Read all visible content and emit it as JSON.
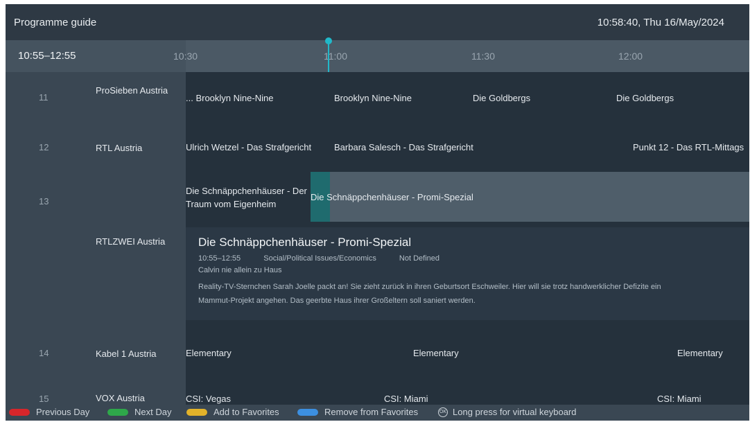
{
  "header": {
    "title": "Programme guide",
    "clock": "10:58:40, Thu 16/May/2024"
  },
  "timeline": {
    "range": "10:55–12:55",
    "ticks": [
      "10:30",
      "11:00",
      "11:30",
      "12:00"
    ]
  },
  "channels": [
    {
      "number": "11",
      "name": "ProSieben Austria",
      "programmes": [
        "... Brooklyn Nine-Nine",
        "Brooklyn Nine-Nine",
        "Die Goldbergs",
        "Die Goldbergs"
      ]
    },
    {
      "number": "12",
      "name": "RTL Austria",
      "programmes": [
        "Ulrich Wetzel - Das Strafgericht",
        "Barbara Salesch - Das Strafgericht",
        "Punkt 12 - Das RTL-Mittags"
      ]
    },
    {
      "number": "13",
      "name": "RTLZWEI Austria",
      "programmes": [
        "Die Schnäppchenhäuser - Der Traum vom Eigenheim",
        "Die Schnäppchenhäuser - Promi-Spezial"
      ]
    },
    {
      "number": "14",
      "name": "Kabel 1 Austria",
      "programmes": [
        "Elementary",
        "Elementary",
        "Elementary"
      ]
    },
    {
      "number": "15",
      "name": "VOX Austria",
      "programmes": [
        "CSI: Vegas",
        "CSI: Miami",
        "CSI: Miami"
      ]
    }
  ],
  "detail": {
    "title": "Die Schnäppchenhäuser - Promi-Spezial",
    "time": "10:55–12:55",
    "genre": "Social/Political Issues/Economics",
    "rating": "Not Defined",
    "episode": "Calvin nie allein zu Haus",
    "description": "Reality-TV-Sternchen Sarah Joelle packt an! Sie zieht zurück in ihren Geburtsort Eschweiler. Hier will sie trotz handwerklicher Defizite ein Mammut-Projekt angehen. Das geerbte Haus ihrer Großeltern soll saniert werden."
  },
  "footer": {
    "previous_day": "Previous Day",
    "next_day": "Next Day",
    "add_favorites": "Add to Favorites",
    "remove_favorites": "Remove from Favorites",
    "ok_hint": "Long press for virtual keyboard",
    "ok_icon_label": "OK"
  },
  "colors": {
    "accent": "#21b8c9",
    "red": "#d6262b",
    "green": "#2ea84a",
    "yellow": "#e3b32a",
    "blue": "#3c8fe0"
  },
  "icons": [
    "now-indicator-icon",
    "ok-button-icon"
  ]
}
